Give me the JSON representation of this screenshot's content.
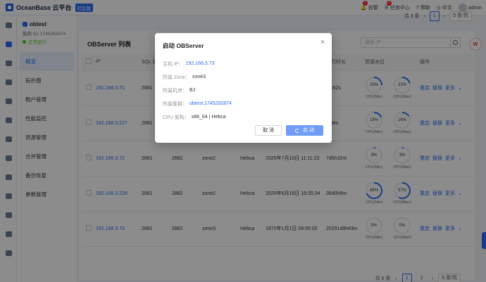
{
  "header": {
    "brand": "OceanBase 云平台",
    "edition_tag": "社区版",
    "alerts": {
      "label": "告警",
      "count": "1"
    },
    "tasks": {
      "label": "任务中心",
      "count": "2"
    },
    "help": "帮助",
    "lang": "中文",
    "user": "admin"
  },
  "sidebar": {
    "cluster_name": "obtest",
    "cluster_id": "集群 ID: 1745292874",
    "cluster_status": "正常运行",
    "items": [
      {
        "label": "概览"
      },
      {
        "label": "拓扑图"
      },
      {
        "label": "租户管理"
      },
      {
        "label": "性能监控"
      },
      {
        "label": "资源管理"
      },
      {
        "label": "合并管理"
      },
      {
        "label": "备份恢复"
      },
      {
        "label": "参数管理"
      }
    ]
  },
  "top_pager": {
    "total": "共 3 条",
    "page": "1",
    "size": "5 条/页"
  },
  "observer": {
    "title": "OBServer 列表",
    "search_placeholder": "搜索 IP",
    "columns": [
      "IP",
      "SQL 端口",
      "",
      "",
      "",
      "",
      "运行时长",
      "资源水位",
      "操作"
    ],
    "rows": [
      {
        "ip": "192.168.3.71",
        "sql_port": "2881",
        "rpc_port": "",
        "zone": "",
        "idc": "",
        "start_time": "",
        "uptime": "3m52s",
        "cpu_min": "25%",
        "cpu_max": "21%",
        "cpu_min_val": 25,
        "cpu_max_val": 21
      },
      {
        "ip": "192.168.3.227",
        "sql_port": "2881",
        "rpc_port": "",
        "zone": "",
        "idc": "",
        "start_time": "",
        "uptime": "0h8m",
        "cpu_min": "19%",
        "cpu_max": "16%",
        "cpu_min_val": 19,
        "cpu_max_val": 16
      },
      {
        "ip": "192.168.3.72",
        "sql_port": "2881",
        "rpc_port": "2882",
        "zone": "zone2",
        "idc": "Hebca",
        "start_time": "2025年7月15日 11:11:23",
        "uptime": "7d5h32m",
        "cpu_min": "3%",
        "cpu_max": "3%",
        "cpu_min_val": 3,
        "cpu_max_val": 3
      },
      {
        "ip": "192.168.3.228",
        "sql_port": "2881",
        "rpc_port": "2882",
        "zone": "zone2",
        "idc": "Hebca",
        "start_time": "2025年6月16日 16:35:34",
        "uptime": "36d0h8m",
        "cpu_min": "69%",
        "cpu_max": "57%",
        "cpu_min_val": 69,
        "cpu_max_val": 57
      },
      {
        "ip": "192.168.3.73",
        "sql_port": "2881",
        "rpc_port": "2882",
        "zone": "zone3",
        "idc": "Hebca",
        "start_time": "1970年1月1日 08:00:00",
        "uptime": "20291d8h43m",
        "cpu_min": "0%",
        "cpu_max": "0%",
        "cpu_min_val": 0,
        "cpu_max_val": 0
      }
    ],
    "cpu_min_label": "CPU(Min)",
    "cpu_max_label": "CPU(Max)",
    "actions": [
      "重启",
      "替换",
      "更多"
    ],
    "pager": {
      "total": "共 6 条",
      "p1": "1",
      "p2": "2",
      "size": "5 条/页"
    }
  },
  "modal": {
    "title": "启动 OBServer",
    "close": "×",
    "rows": [
      {
        "label": "主机 IP：",
        "value": "192.168.3.73",
        "is_link": true
      },
      {
        "label": "所属 Zone：",
        "value": "zone3",
        "is_link": false
      },
      {
        "label": "所属机房：",
        "value": "BJ",
        "is_link": false
      },
      {
        "label": "所属集群：",
        "value": "obtest:1745292874",
        "is_link": true
      },
      {
        "label": "CPU 架构：",
        "value": "x86_64 | Hebca",
        "is_link": false
      }
    ],
    "cancel": "取 消",
    "confirm": "启 动"
  },
  "colors": {
    "accent": "#2a6ef5",
    "gauge_track": "#e8ecf3"
  }
}
